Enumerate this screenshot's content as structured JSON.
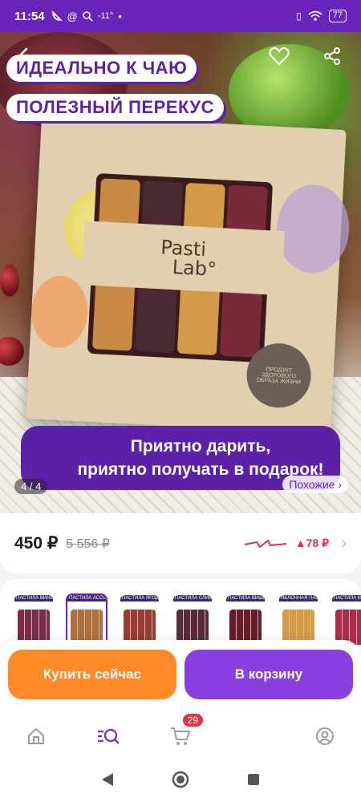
{
  "status_bar": {
    "time": "11:54",
    "temperature": "-11°",
    "battery": "77"
  },
  "hero": {
    "tag_1": "ИДЕАЛЬНО К ЧАЮ",
    "tag_2": "ПОЛЕЗНЫЙ ПЕРЕКУС",
    "brand_line_1": "Pasti",
    "brand_line_2": "Lab°",
    "stamp_text": "ПРОДУКТ ЗДОРОВОГО ОБРАЗА ЖИЗНИ",
    "banner_line_1": "Приятно дарить,",
    "banner_line_2": "приятно получать в подарок!",
    "image_counter": "4 / 4",
    "similar_label": "Похожие ›"
  },
  "price": {
    "current": "450 ₽",
    "old": "5 556 ₽",
    "change": "▲78 ₽"
  },
  "variants": [
    {
      "title": "ПАСТИЛА ВИНОГРАДНАЯ",
      "color": "#7a2c4a",
      "selected": false
    },
    {
      "title": "ПАСТИЛА АССОРТИ",
      "color": "#b0703a",
      "selected": true
    },
    {
      "title": "ПАСТИЛА ЯГОДНОЕ АССОРТИ",
      "color": "#9a3a30",
      "selected": false
    },
    {
      "title": "ПАСТИЛА СЛИВОВАЯ",
      "color": "#5a2a3a",
      "selected": false
    },
    {
      "title": "ПАСТИЛА ВИШНЁВАЯ",
      "color": "#6a1a2a",
      "selected": false
    },
    {
      "title": "ЯБЛОЧНАЯ ПАСТИЛА",
      "color": "#d99a40",
      "selected": false
    },
    {
      "title": "ПАСТИЛА МАЛИНОВАЯ",
      "color": "#b02a4a",
      "selected": false
    }
  ],
  "actions": {
    "buy_now": "Купить сейчас",
    "add_to_cart": "В корзину"
  },
  "bottom_nav": {
    "cart_badge": "29"
  },
  "colors": {
    "brand_purple": "#6a23b8",
    "buy_orange": "#ff8a2a",
    "cart_purple": "#8a3fe0",
    "price_up_red": "#e1324a"
  }
}
